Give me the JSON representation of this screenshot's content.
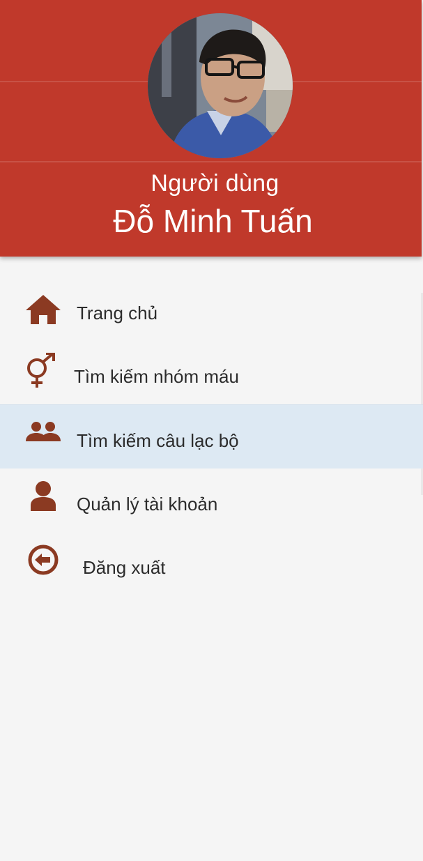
{
  "profile": {
    "role": "Người dùng",
    "name": "Đỗ Minh Tuấn",
    "avatar_icon": "user-photo"
  },
  "colors": {
    "header": "#c0392b",
    "icon": "#8b3a22",
    "active_row": "#dde9f3",
    "background": "#f5f5f5"
  },
  "menu": {
    "items": [
      {
        "label": "Trang chủ",
        "icon": "home-icon",
        "active": false
      },
      {
        "label": "Tìm kiếm nhóm máu",
        "icon": "gender-icon",
        "active": false
      },
      {
        "label": "Tìm kiếm câu lạc bộ",
        "icon": "people-icon",
        "active": true
      },
      {
        "label": "Quản lý tài khoản",
        "icon": "user-icon",
        "active": false
      },
      {
        "label": "Đăng xuất",
        "icon": "logout-icon",
        "active": false
      }
    ]
  }
}
